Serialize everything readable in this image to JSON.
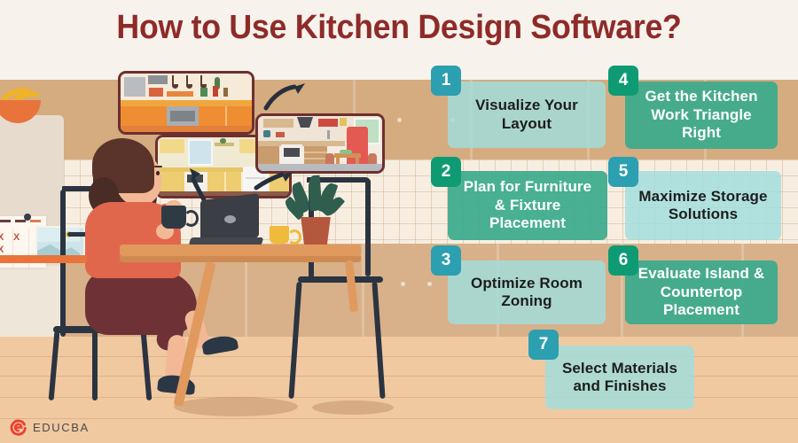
{
  "title": "How to Use Kitchen Design Software?",
  "brand": {
    "name": "EDUCBA",
    "mark": "educba-logo-icon",
    "mark_color": "#ef3d2e",
    "text_color": "#4a4a4a"
  },
  "theme": {
    "title_color": "#8e2b29",
    "badge_teal": "#2c9fb0",
    "badge_green": "#0e9b74",
    "step_light_bg": "#a0dedd",
    "step_dark_bg": "#3aaa8c",
    "step_light_text": "#1d1d1d",
    "step_dark_text": "#ffffff",
    "wall": "#f7f2ec",
    "cabinet": "#d5ab80",
    "tile": "#f7eee1",
    "floor": "#f0c9a1"
  },
  "steps": [
    {
      "number": "1",
      "label": "Visualize Your Layout",
      "style": "light",
      "badge": "teal"
    },
    {
      "number": "2",
      "label": "Plan for Furniture & Fixture Placement",
      "style": "dark",
      "badge": "green"
    },
    {
      "number": "3",
      "label": "Optimize Room Zoning",
      "style": "light",
      "badge": "teal"
    },
    {
      "number": "4",
      "label": "Get the Kitchen Work Triangle Right",
      "style": "dark",
      "badge": "green"
    },
    {
      "number": "5",
      "label": "Maximize Storage Solutions",
      "style": "light",
      "badge": "teal"
    },
    {
      "number": "6",
      "label": "Evaluate Island & Countertop Placement",
      "style": "dark",
      "badge": "green"
    },
    {
      "number": "7",
      "label": "Select Materials and Finishes",
      "style": "light",
      "badge": "teal"
    }
  ],
  "illustration": {
    "scene": "woman-at-desk-designing-kitchen",
    "person": "woman-with-coffee-mug-at-laptop",
    "objects": [
      "laptop-icon",
      "coffee-mug-icon",
      "potted-plant-icon",
      "wire-chair-icon",
      "wooden-table-icon",
      "wall-calendar-icon",
      "framed-picture-icon",
      "fruit-bowl-icon"
    ],
    "preview_cards": [
      "kitchen-preview-orange-modern",
      "kitchen-preview-yellow-classic",
      "kitchen-preview-red-island"
    ],
    "arrows": [
      "curved-arrow-up-left",
      "curved-arrow-up-right",
      "curved-arrow-up"
    ]
  }
}
